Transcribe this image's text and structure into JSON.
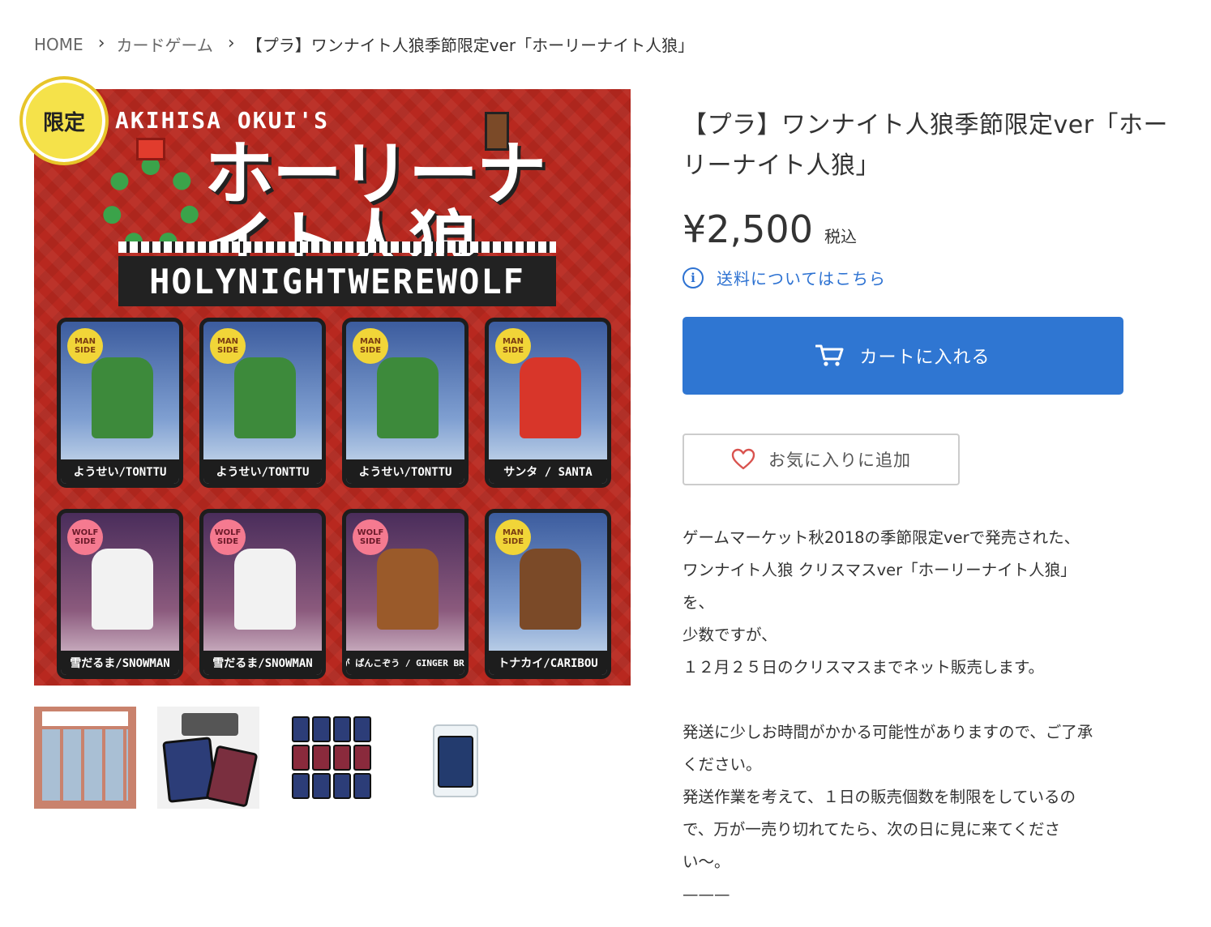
{
  "breadcrumb": {
    "home": "HOME",
    "category": "カードゲーム",
    "current": "【プラ】ワンナイト人狼季節限定ver「ホーリーナイト人狼」"
  },
  "image": {
    "badge": "限定",
    "author": "AKIHISA OKUI'S",
    "title_jp": "ホーリーナイト人狼",
    "title_en": "HOLYNIGHTWEREWOLF",
    "cards": [
      {
        "side": [
          "MAN",
          "SIDE"
        ],
        "name": "ようせい/TONTTU",
        "type": "man",
        "color": "#3d8a3b"
      },
      {
        "side": [
          "MAN",
          "SIDE"
        ],
        "name": "ようせい/TONTTU",
        "type": "man",
        "color": "#3d8a3b"
      },
      {
        "side": [
          "MAN",
          "SIDE"
        ],
        "name": "ようせい/TONTTU",
        "type": "man",
        "color": "#3d8a3b"
      },
      {
        "side": [
          "MAN",
          "SIDE"
        ],
        "name": "サンタ / SANTA",
        "type": "man",
        "color": "#d8362a"
      },
      {
        "side": [
          "WOLF",
          "SIDE"
        ],
        "name": "雪だるま/SNOWMAN",
        "type": "wolf",
        "color": "#f2f2f2"
      },
      {
        "side": [
          "WOLF",
          "SIDE"
        ],
        "name": "雪だるま/SNOWMAN",
        "type": "wolf",
        "color": "#f2f2f2"
      },
      {
        "side": [
          "WOLF",
          "SIDE"
        ],
        "name": "しょうが ぱんこぞう / GINGER BREADMAN",
        "type": "wolf",
        "color": "#9a5a2a"
      },
      {
        "side": [
          "MAN",
          "SIDE"
        ],
        "name": "トナカイ/CARIBOU",
        "type": "man",
        "color": "#7b4a28"
      }
    ]
  },
  "product": {
    "title": "【プラ】ワンナイト人狼季節限定ver「ホーリーナイト人狼」",
    "price": "¥2,500",
    "tax_label": "税込",
    "shipping_link": "送料についてはこちら",
    "cart_button": "カートに入れる",
    "favorite_button": "お気に入りに追加"
  },
  "description": [
    "ゲームマーケット秋2018の季節限定verで発売された、",
    "ワンナイト人狼 クリスマスver「ホーリーナイト人狼」",
    "を、",
    "少数ですが、",
    "１２月２５日のクリスマスまでネット販売します。",
    "",
    "発送に少しお時間がかかる可能性がありますので、ご了承",
    "ください。",
    "発送作業を考えて、１日の販売個数を制限をしているの",
    "で、万が一売り切れてたら、次の日に見に来てくださ",
    "い〜。",
    "———"
  ],
  "colors": {
    "accent": "#2f76d2",
    "link": "#2d72d2",
    "image_background": "#b8281f",
    "badge": "#f5e24a"
  },
  "icons": {
    "breadcrumb_separator": "chevron-right-icon",
    "shipping": "info-icon",
    "cart": "cart-icon",
    "favorite": "heart-icon"
  }
}
